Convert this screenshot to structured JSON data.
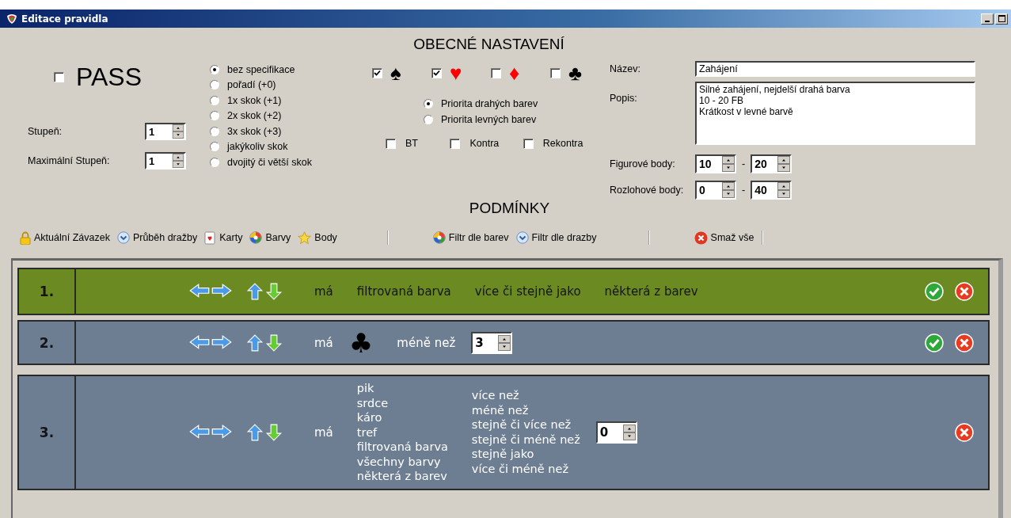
{
  "window": {
    "title": "Editace pravidla"
  },
  "pass": {
    "label": "PASS",
    "checked": false
  },
  "levels": [
    {
      "label": "Stupeň:",
      "value": "1"
    },
    {
      "label": "Maximální Stupeň:",
      "value": "1"
    }
  ],
  "jump_options": [
    {
      "label": "bez specifikace",
      "selected": true
    },
    {
      "label": "pořadí (+0)",
      "selected": false
    },
    {
      "label": "1x skok (+1)",
      "selected": false
    },
    {
      "label": "2x skok (+2)",
      "selected": false
    },
    {
      "label": "3x skok (+3)",
      "selected": false
    },
    {
      "label": "jakýkoliv skok",
      "selected": false
    },
    {
      "label": "dvojitý či větší skok",
      "selected": false
    }
  ],
  "general_title": "OBECNÉ NASTAVENÍ",
  "suits": [
    {
      "symbol": "♠",
      "checked": true,
      "color": "#000000"
    },
    {
      "symbol": "♥",
      "checked": true,
      "color": "#ff0000"
    },
    {
      "symbol": "♦",
      "checked": false,
      "color": "#ff0000"
    },
    {
      "symbol": "♣",
      "checked": false,
      "color": "#000000"
    }
  ],
  "priority": [
    {
      "label": "Priorita drahých barev",
      "selected": true
    },
    {
      "label": "Priorita levných barev",
      "selected": false
    }
  ],
  "flags": [
    {
      "label": "BT",
      "checked": false
    },
    {
      "label": "Kontra",
      "checked": false
    },
    {
      "label": "Rekontra",
      "checked": false
    }
  ],
  "name": {
    "label": "Název:",
    "value": "Zahájení"
  },
  "description": {
    "label": "Popis:",
    "value": "Silné zahájení, nejdelší drahá barva\n10 - 20 FB\nKrátkost v levné barvě"
  },
  "ranges": [
    {
      "label": "Figurové body:",
      "from": "10",
      "separator": "-",
      "to": "20"
    },
    {
      "label": "Rozlohové body:",
      "from": "0",
      "separator": "-",
      "to": "40"
    }
  ],
  "conditions_title": "PODMÍNKY",
  "toolbar": [
    {
      "kind": "lock",
      "label": "Aktuální Závazek"
    },
    {
      "kind": "chevron",
      "label": "Průběh dražby"
    },
    {
      "kind": "card",
      "label": "Karty"
    },
    {
      "kind": "wheel",
      "label": "Barvy"
    },
    {
      "kind": "star",
      "label": "Body"
    },
    {
      "kind": "separator"
    },
    {
      "kind": "wheel",
      "label": "Filtr dle barev"
    },
    {
      "kind": "chevron",
      "label": "Filtr dle drazby"
    },
    {
      "kind": "separator"
    },
    {
      "kind": "delete",
      "label": "Smaž vše"
    },
    {
      "kind": "separator"
    }
  ],
  "rules": [
    {
      "number": "1.",
      "selected": true,
      "confirm": true,
      "parts": [
        {
          "kind": "text",
          "text": "má"
        },
        {
          "kind": "text",
          "text": "filtrovaná barva"
        },
        {
          "kind": "text",
          "text": "více či stejně jako"
        },
        {
          "kind": "text",
          "text": "některá z barev"
        }
      ]
    },
    {
      "number": "2.",
      "selected": false,
      "confirm": true,
      "parts": [
        {
          "kind": "text",
          "text": "má"
        },
        {
          "kind": "suit",
          "text": "♣"
        },
        {
          "kind": "text",
          "text": "méně než"
        },
        {
          "kind": "spinner",
          "text": "3"
        }
      ]
    },
    {
      "number": "3.",
      "selected": false,
      "confirm": false,
      "parts": [
        {
          "kind": "text",
          "text": "má"
        },
        {
          "kind": "list",
          "items": [
            "pik",
            "srdce",
            "káro",
            "tref",
            "filtrovaná barva",
            "všechny barvy",
            "některá z barev"
          ]
        },
        {
          "kind": "list",
          "items": [
            "více než",
            "méně než",
            "stejně či více než",
            "stejně či méně než",
            "stejně jako",
            "více či méně než"
          ]
        },
        {
          "kind": "spinner",
          "text": "0"
        }
      ]
    }
  ]
}
